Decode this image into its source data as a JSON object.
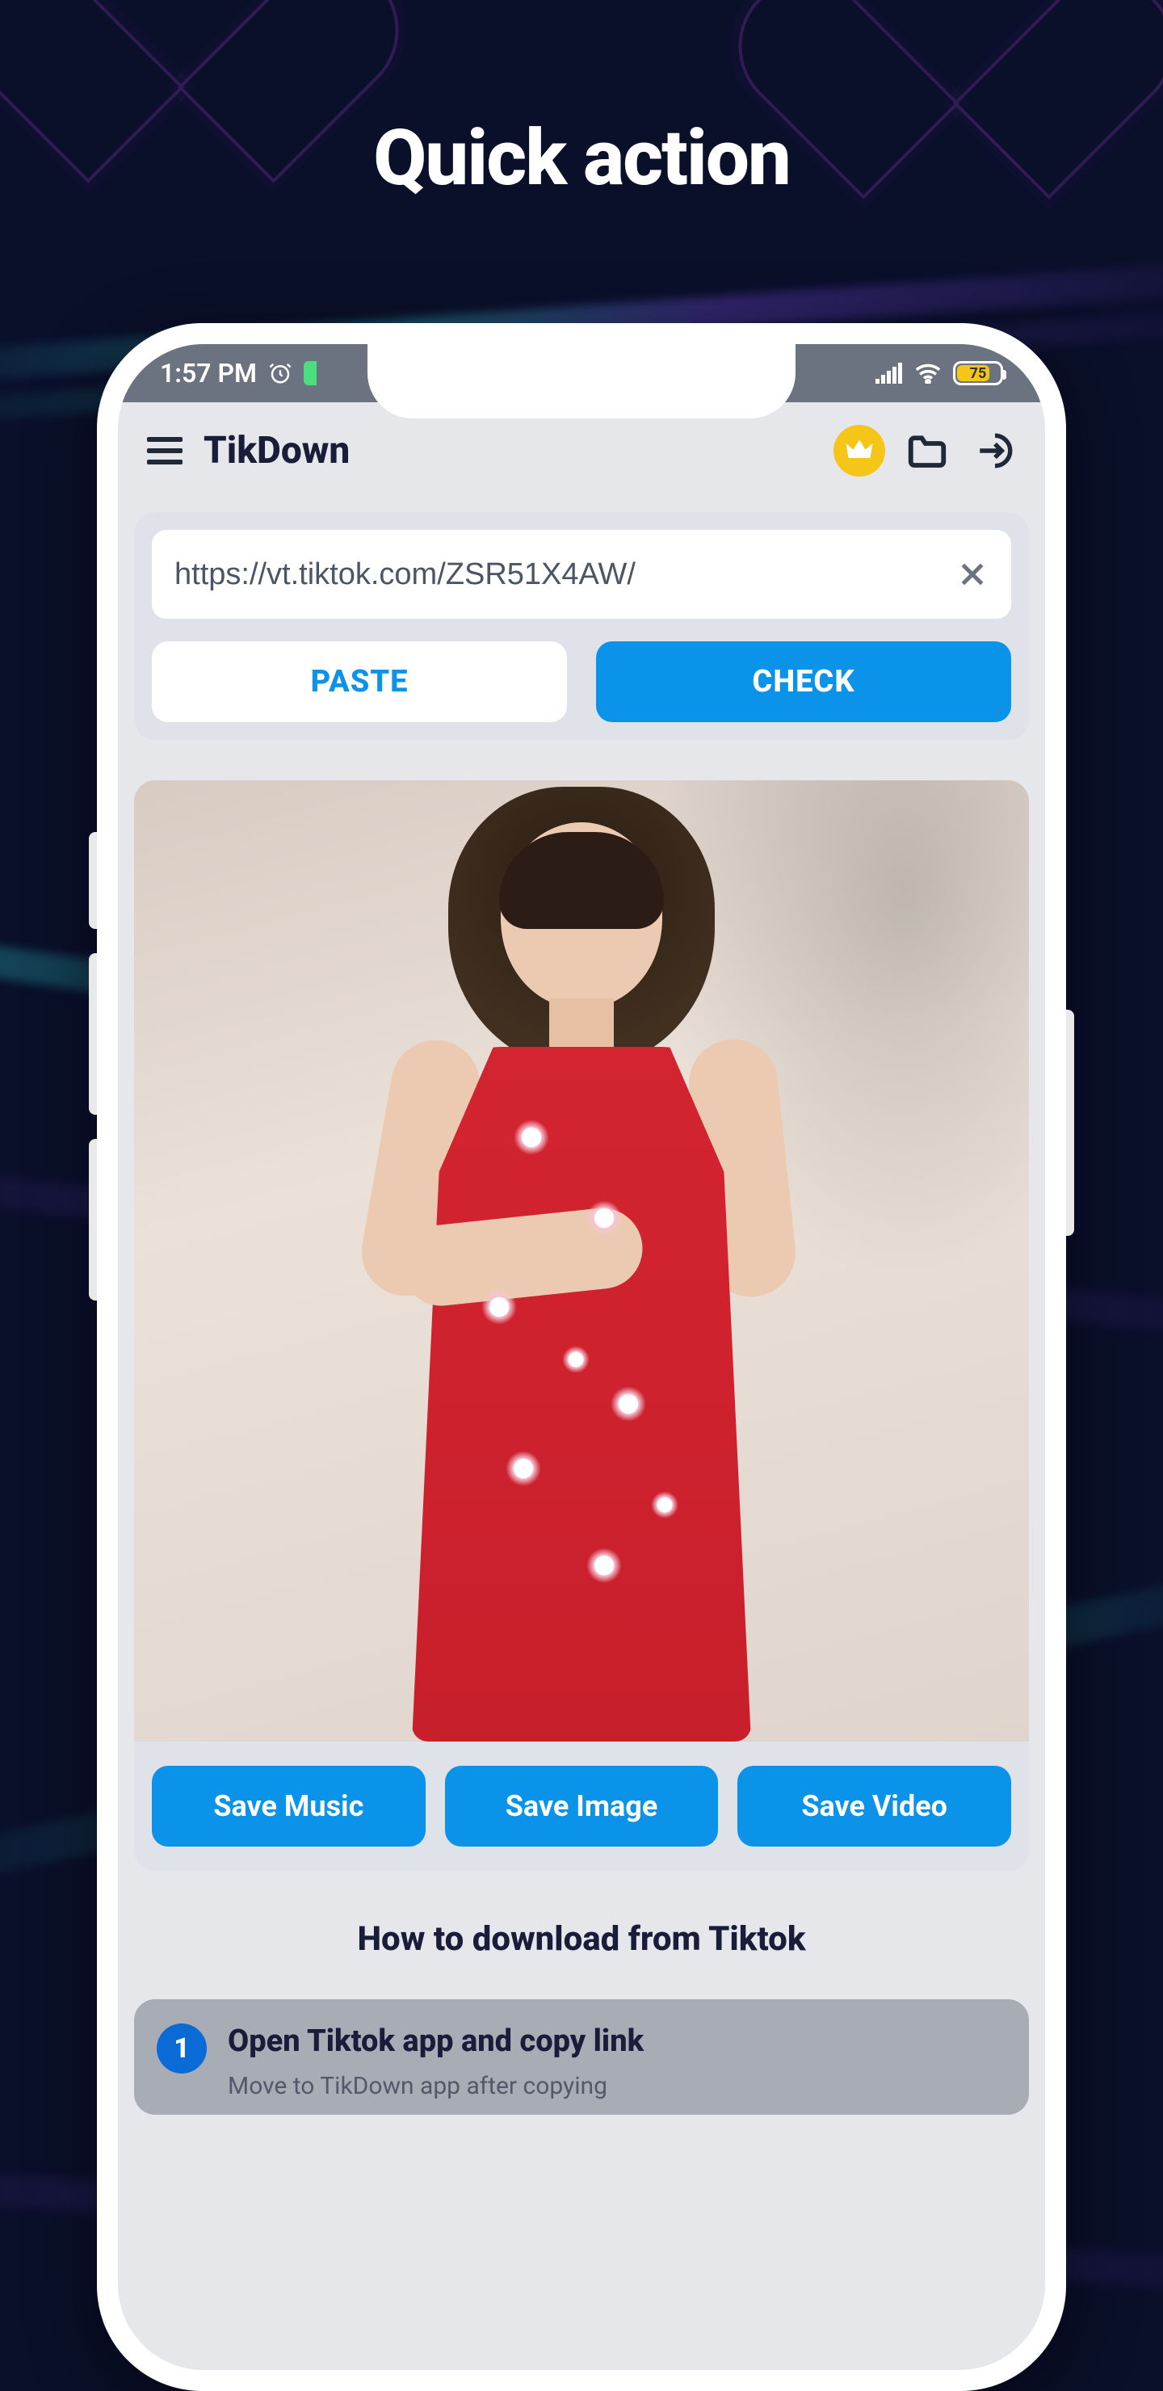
{
  "promo": {
    "title": "Quick action"
  },
  "status": {
    "time": "1:57 PM",
    "battery": "75"
  },
  "header": {
    "app_name": "TikDown"
  },
  "url_card": {
    "input_value": "https://vt.tiktok.com/ZSR51X4AW/",
    "paste_label": "PASTE",
    "check_label": "CHECK"
  },
  "save": {
    "music": "Save Music",
    "image": "Save Image",
    "video": "Save Video"
  },
  "howto": {
    "title": "How to download from Tiktok",
    "step1_number": "1",
    "step1_title": "Open Tiktok app and copy link",
    "step1_sub": "Move to TikDown app after copying"
  },
  "colors": {
    "accent": "#0a93e8"
  }
}
